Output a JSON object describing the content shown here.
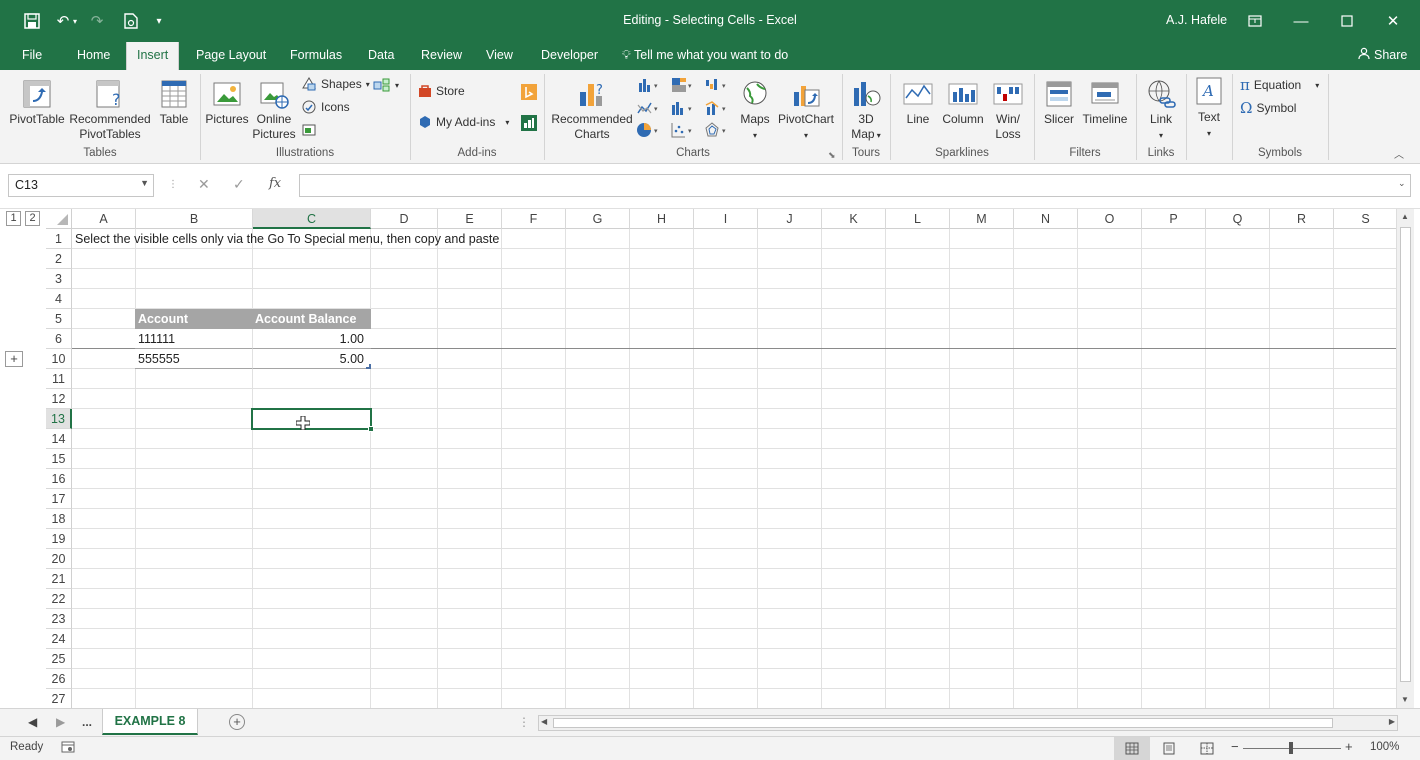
{
  "window": {
    "title": "Editing - Selecting Cells  -  Excel",
    "user": "A.J. Hafele"
  },
  "menu": {
    "tabs": [
      {
        "label": "File"
      },
      {
        "label": "Home"
      },
      {
        "label": "Insert"
      },
      {
        "label": "Page Layout"
      },
      {
        "label": "Formulas"
      },
      {
        "label": "Data"
      },
      {
        "label": "Review"
      },
      {
        "label": "View"
      },
      {
        "label": "Developer"
      }
    ],
    "active_tab": "Insert",
    "tell_me": "Tell me what you want to do",
    "share": "Share"
  },
  "ribbon": {
    "tables": {
      "label": "Tables",
      "pivottable": "PivotTable",
      "recommended_line1": "Recommended",
      "recommended_line2": "PivotTables",
      "table": "Table"
    },
    "illustrations": {
      "label": "Illustrations",
      "pictures": "Pictures",
      "online_line1": "Online",
      "online_line2": "Pictures",
      "shapes": "Shapes",
      "icons": "Icons"
    },
    "addins": {
      "label": "Add-ins",
      "store": "Store",
      "my_addins": "My Add-ins"
    },
    "charts": {
      "label": "Charts",
      "recommended_line1": "Recommended",
      "recommended_line2": "Charts",
      "maps": "Maps",
      "pivotchart": "PivotChart"
    },
    "tours": {
      "label": "Tours",
      "map_line1": "3D",
      "map_line2": "Map"
    },
    "sparklines": {
      "label": "Sparklines",
      "line": "Line",
      "column": "Column",
      "winloss_line1": "Win/",
      "winloss_line2": "Loss"
    },
    "filters": {
      "label": "Filters",
      "slicer": "Slicer",
      "timeline": "Timeline"
    },
    "links": {
      "label": "Links",
      "link": "Link"
    },
    "text": {
      "label": "Text",
      "text": "Text"
    },
    "symbols": {
      "label": "Symbols",
      "equation": "Equation",
      "symbol": "Symbol"
    }
  },
  "formula_bar": {
    "name_box": "C13",
    "formula": ""
  },
  "outline_levels": [
    "1",
    "2"
  ],
  "columns": [
    "A",
    "B",
    "C",
    "D",
    "E",
    "F",
    "G",
    "H",
    "I",
    "J",
    "K",
    "L",
    "M",
    "N",
    "O",
    "P",
    "Q",
    "R",
    "S"
  ],
  "rows": [
    "1",
    "2",
    "3",
    "4",
    "5",
    "6",
    "10",
    "11",
    "12",
    "13",
    "14",
    "15",
    "16",
    "17",
    "18",
    "19",
    "20",
    "21",
    "22",
    "23",
    "24",
    "25",
    "26",
    "27"
  ],
  "selected": {
    "column": "C",
    "row": "13"
  },
  "sheet": {
    "instruction": "Select the visible cells only via the Go To Special menu, then copy and paste",
    "table": {
      "headers": [
        "Account",
        "Account Balance"
      ],
      "rows": [
        {
          "account": "111111",
          "balance": "1.00"
        },
        {
          "account": "555555",
          "balance": "5.00"
        }
      ]
    }
  },
  "sheet_tabs": {
    "ellipsis": "...",
    "active": "EXAMPLE 8"
  },
  "status": {
    "ready": "Ready",
    "zoom": "100%"
  }
}
